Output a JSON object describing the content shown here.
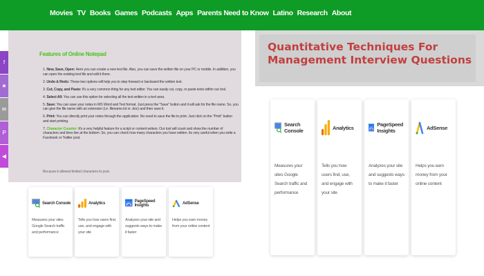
{
  "nav": {
    "items": [
      "Movies",
      "TV",
      "Books",
      "Games",
      "Podcasts",
      "Apps",
      "Parents Need to Know",
      "Latino",
      "Research",
      "About"
    ]
  },
  "social": {
    "icons": [
      {
        "name": "facebook-icon",
        "glyph": "f",
        "color": "#8b45c5"
      },
      {
        "name": "twitter-icon",
        "glyph": "★",
        "color": "#a16bd2"
      },
      {
        "name": "email-icon",
        "glyph": "✉",
        "color": "#9a9a9a"
      },
      {
        "name": "pinterest-icon",
        "glyph": "P",
        "color": "#b05fd6"
      },
      {
        "name": "share-icon",
        "glyph": "◀",
        "color": "#c14adb"
      }
    ]
  },
  "notes": {
    "title": "Features of Online Notepad",
    "items": [
      {
        "label": "New, Save, Open:",
        "text": "Here you can create a new text file. Also, you can save the written file on your PC or mobile. In addition, you can open the existing text file and edit it there."
      },
      {
        "label": "Undo & Redo:",
        "text": "These two options will help you to step forward or backward the written text."
      },
      {
        "label": "Cut, Copy, and Paste:",
        "text": "It's a very common thing for any text editor. You can easily cut, copy, or paste texts within our tool."
      },
      {
        "label": "Select All:",
        "text": "You can use this option for selecting all the text written in a text area."
      },
      {
        "label": "Save:",
        "text": "You can save your notes in MS Word and Text format. Just press the \"Save\" button and it will ask for the file name. So, you can give the file name with an extension (i.e. filename.txt or .doc) and then save it."
      },
      {
        "label": "Print:",
        "text": "You can directly print your notes through the application. No need to save the file to print. Just click on the \"Print\" button and start printing."
      },
      {
        "label": "Character Counter:",
        "text": "It's a very helpful feature for a script or content writers. Our tool will count and show the number of characters and lines live at the bottom. So, you can check how many characters you have written. Its very useful when you write a Facebook or Twitter post."
      }
    ],
    "footer": "Because it allowed limited characters to post."
  },
  "banner": {
    "title": "Quantitative Techniques For Management Interview Questions"
  },
  "tools": [
    {
      "name": "Search Console",
      "desc": "Measures your sites Google Search traffic and performance",
      "icon": "search-console-icon"
    },
    {
      "name": "Analytics",
      "desc": "Tells you how users find, use, and engage with your site",
      "icon": "analytics-icon"
    },
    {
      "name": "PageSpeed Insights",
      "desc": "Analyzes your site and suggests ways to make it faster",
      "icon": "pagespeed-insights-icon"
    },
    {
      "name": "AdSense",
      "desc": "Helps you earn money from your online content",
      "icon": "adsense-icon"
    }
  ],
  "colors": {
    "nav_bg": "#0e9b26",
    "notes_bg": "#e1dbe0",
    "notes_title": "#49c317",
    "banner_title": "#c23f3f"
  }
}
